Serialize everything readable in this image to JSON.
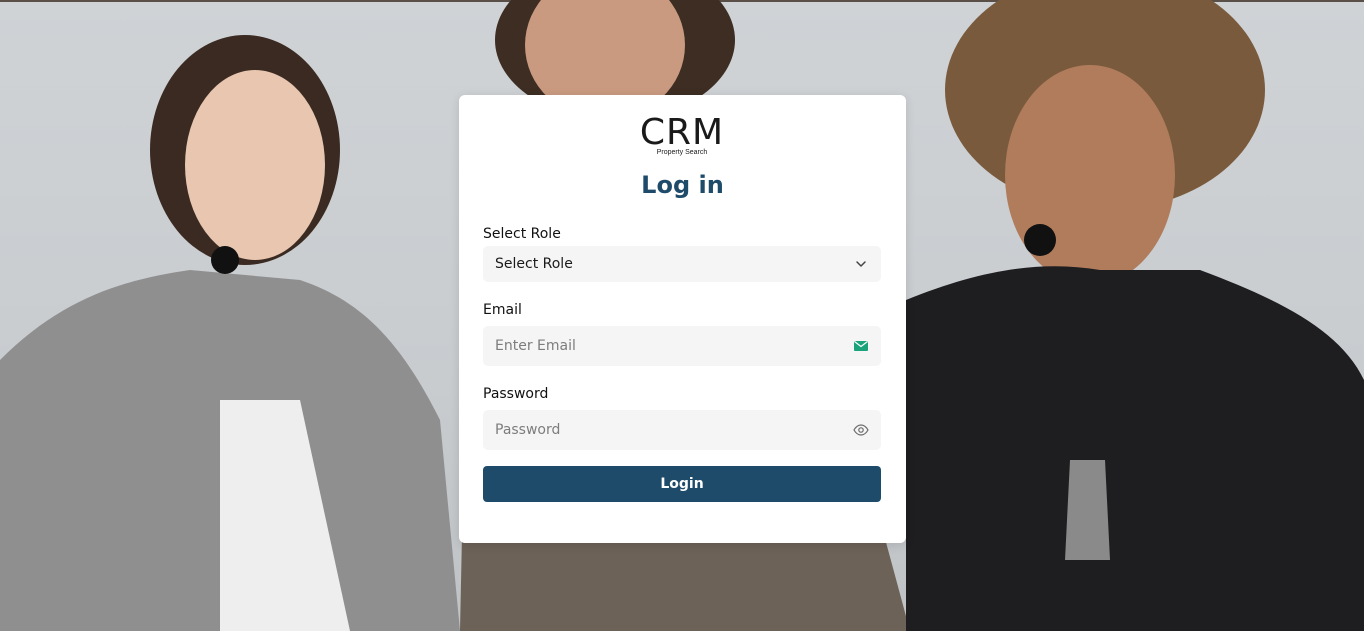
{
  "brand": {
    "logo_text": "CRM",
    "logo_subtitle": "Property Search"
  },
  "login": {
    "title": "Log in",
    "role_label": "Select Role",
    "role_selected": "Select Role",
    "email_label": "Email",
    "email_placeholder": "Enter Email",
    "password_label": "Password",
    "password_placeholder": "Password",
    "submit_label": "Login"
  },
  "icons": {
    "role_dropdown": "chevron-down-icon",
    "email": "mail-icon",
    "password": "eye-icon"
  },
  "colors": {
    "primary": "#1f4b6b",
    "field_bg": "#f5f5f5",
    "mail_icon": "#1aa37a"
  }
}
